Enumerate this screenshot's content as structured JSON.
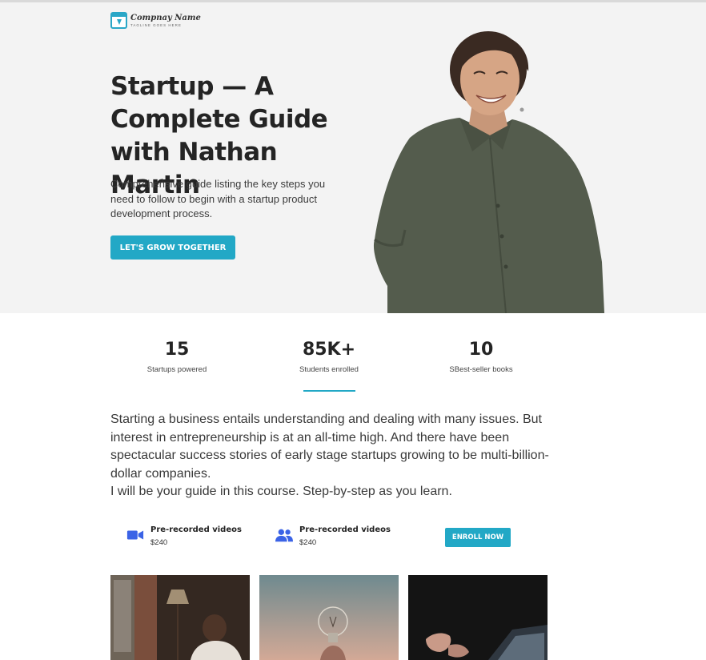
{
  "brand": {
    "name": "Compnay Name",
    "tagline": "TAGLINE GOES HERE"
  },
  "hero": {
    "title": "Startup — A Complete Guide with Nathan Martin",
    "description": "Comprehensive guide listing the key steps you need to follow to begin with a startup product development process.",
    "cta_label": "LET'S GROW TOGETHER"
  },
  "stats": [
    {
      "value": "15",
      "label": "Startups powered"
    },
    {
      "value": "85K+",
      "label": "Students enrolled"
    },
    {
      "value": "10",
      "label": "SBest-seller books"
    }
  ],
  "intro": {
    "paragraph": "Starting a business entails understanding and dealing with many issues. But interest in entrepreneurship is at an all-time high. And there have been spectacular success stories of early stage startups growing to be multi-billion-dollar companies.",
    "closing": "I will be your guide in this course. Step-by-step as you learn."
  },
  "offers": [
    {
      "icon": "video-camera-icon",
      "title": "Pre-recorded videos",
      "price": "$240"
    },
    {
      "icon": "users-icon",
      "title": "Pre-recorded videos",
      "price": "$240"
    }
  ],
  "enroll_label": "ENROLL NOW",
  "colors": {
    "accent": "#22a8c6",
    "hero_background": "#f3f3f3",
    "icon_blue": "#3b63e6"
  }
}
